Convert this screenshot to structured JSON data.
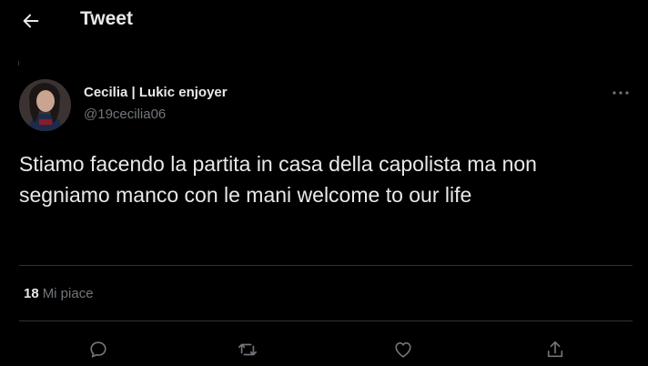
{
  "header": {
    "back_icon": "arrow-left-icon",
    "title": "Tweet"
  },
  "tweet": {
    "author": {
      "display_name": "Cecilia | Lukic enjoyer",
      "handle": "@19cecilia06"
    },
    "text": "Stiamo facendo la partita in casa della capolista ma non segniamo manco con le mani welcome to our life",
    "stats": {
      "likes_count": "18",
      "likes_label": "Mi piace"
    },
    "actions": {
      "icons": [
        "reply-icon",
        "retweet-icon",
        "like-icon",
        "share-icon"
      ]
    }
  },
  "colors": {
    "background": "#000000",
    "primary_text": "#e7e9ea",
    "secondary_text": "#71767b",
    "divider": "#2f3336"
  }
}
